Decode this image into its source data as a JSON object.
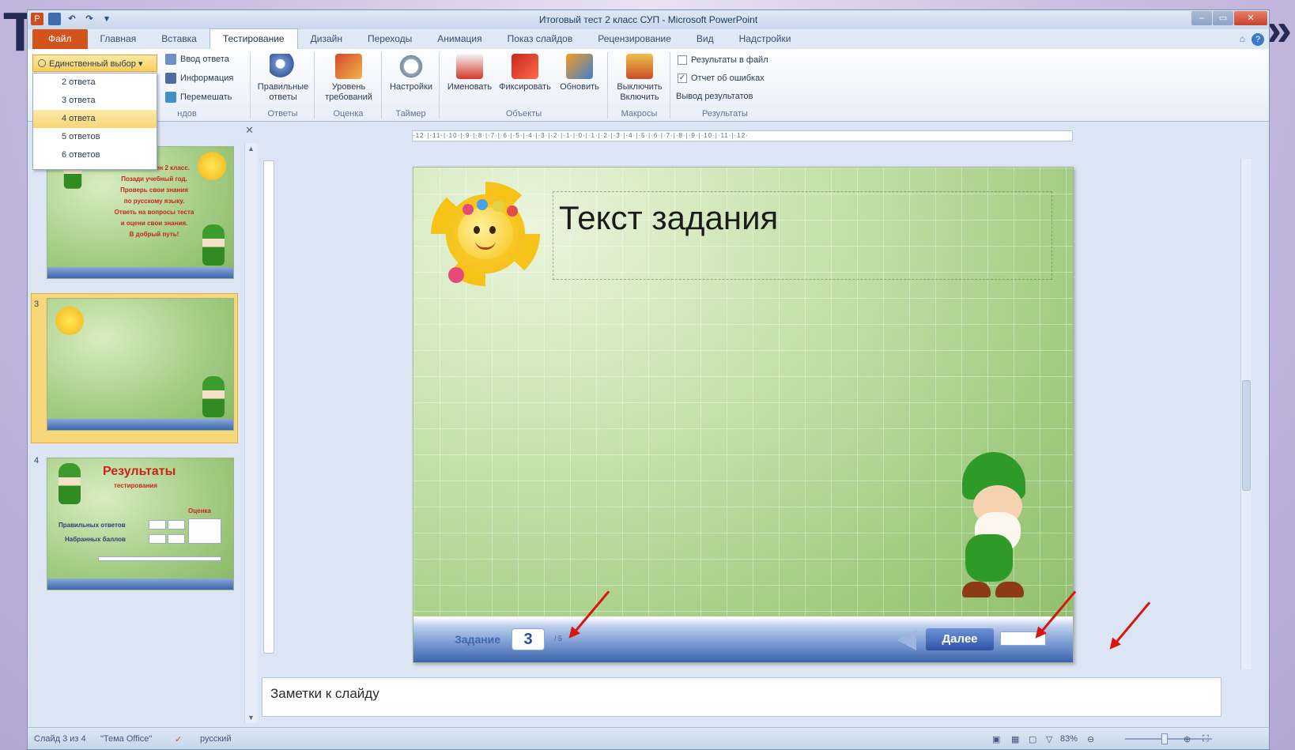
{
  "backdrop": {
    "title": "Т",
    "quote": "»"
  },
  "window": {
    "title": "Итоговый тест 2 класс СУП - Microsoft PowerPoint",
    "qat": {
      "app": "P",
      "undo": "↶",
      "redo": "↷",
      "more": "▾"
    },
    "controls": {
      "minimize": "–",
      "maximize": "▭",
      "close": "✕"
    }
  },
  "tabs": [
    "Главная",
    "Вставка",
    "Тестирование",
    "Дизайн",
    "Переходы",
    "Анимация",
    "Показ слайдов",
    "Рецензирование",
    "Вид",
    "Надстройки"
  ],
  "file_tab": "Файл",
  "active_tab": "Тестирование",
  "tabs_right": {
    "minimize_ribbon": "⌂",
    "help": "?"
  },
  "ribbon": {
    "type_select": "Единственный выбор",
    "type_options": [
      "2 ответа",
      "3 ответа",
      "4 ответа",
      "5 ответов",
      "6 ответов"
    ],
    "type_selected": "4 ответа",
    "small_buttons": {
      "input": "Ввод ответа",
      "info": "Информация",
      "shuffle": "Перемешать"
    },
    "group_partial": "ндов",
    "answers_group": {
      "button": "Правильные ответы",
      "label": "Ответы"
    },
    "grade_group": {
      "button": "Уровень требований",
      "label": "Оценка"
    },
    "timer_group": {
      "button": "Настройки",
      "label": "Таймер"
    },
    "objects_group": {
      "buttons": [
        "Именовать",
        "Фиксировать",
        "Обновить"
      ],
      "label": "Объекты"
    },
    "macro_group": {
      "button_line1": "Выключить",
      "button_line2": "Включить",
      "label": "Макросы"
    },
    "results_group": {
      "checkbox_file": "Результаты в файл",
      "checkbox_errors": "Отчет об ошибках",
      "errors_checked": true,
      "output": "Вывод результатов",
      "label": "Результаты"
    }
  },
  "slides_pane": {
    "close": "✕",
    "slide2_lines": [
      "Вот и окончен 2 класс.",
      "Позади учебный год.",
      "Проверь свои знания",
      "по русскому языку.",
      "Ответь на вопросы теста",
      "и оцени свои знания.",
      "В добрый путь!"
    ],
    "slide3_num": "3",
    "slide4_num": "4",
    "slide4": {
      "title": "Результаты",
      "subtitle": "тестирования",
      "grade": "Оценка",
      "correct": "Правильных ответов",
      "points": "Набранных баллов"
    }
  },
  "ruler": "·12·|·11·|·10·|·9·|·8·|·7·|·6·|·5·|·4·|·3·|·2·|·1·|·0·|·1·|·2·|·3·|·4·|·5·|·6·|·7·|·8·|·9·|·10·|·11·|·12·",
  "slide": {
    "title": "Текст задания",
    "nav_label": "Задание",
    "task_number": "3",
    "nav_small": "/ 5",
    "next_button": "Далее"
  },
  "notes": {
    "placeholder": "Заметки к слайду"
  },
  "status": {
    "slide": "Слайд 3 из 4",
    "theme": "\"Тема Office\"",
    "language": "русский",
    "zoom": "83%",
    "zoom_fraction": 0.45
  }
}
